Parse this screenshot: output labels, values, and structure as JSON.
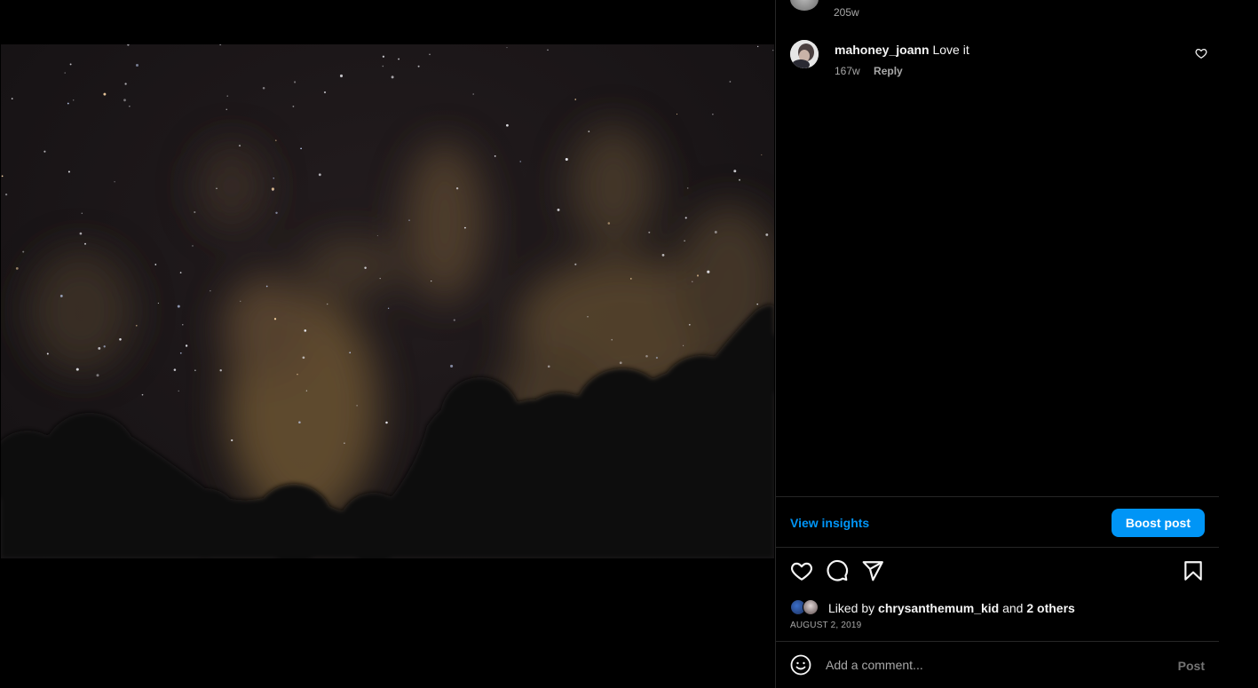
{
  "post": {
    "image_alt": "Night sky with stars, clouds and silhouetted trees"
  },
  "comments": [
    {
      "time": "205w"
    },
    {
      "username": "mahoney_joann",
      "text": "Love it",
      "time": "167w",
      "reply_label": "Reply"
    }
  ],
  "insights": {
    "view_label": "View insights",
    "boost_label": "Boost post"
  },
  "actions": {
    "icons": [
      "heart-icon",
      "comment-icon",
      "share-icon",
      "bookmark-icon"
    ]
  },
  "likes": {
    "prefix": "Liked by",
    "user": "chrysanthemum_kid",
    "middle": "and",
    "others": "2 others"
  },
  "date": "AUGUST 2, 2019",
  "add_comment": {
    "placeholder": "Add a comment...",
    "post_label": "Post"
  },
  "colors": {
    "accent": "#0095f6",
    "background": "#000000",
    "secondary_text": "#a8a8a8",
    "divider": "#262626"
  }
}
